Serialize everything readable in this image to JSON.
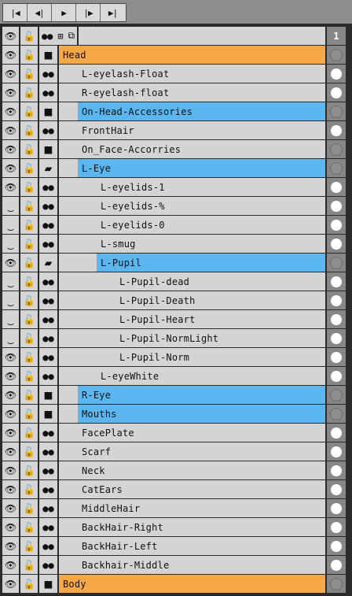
{
  "playback": {
    "buttons": [
      {
        "name": "first-frame-button",
        "glyph": "|◀"
      },
      {
        "name": "prev-frame-button",
        "glyph": "◀|"
      },
      {
        "name": "play-button",
        "glyph": "▶"
      },
      {
        "name": "next-frame-button",
        "glyph": "|▶"
      },
      {
        "name": "last-frame-button",
        "glyph": "▶|"
      }
    ]
  },
  "header": {
    "eye_icon": "👁",
    "lock_icon": "🔓",
    "dots_icon": "●●",
    "tree_icon": "⊞",
    "clone_icon": "⧉",
    "frame_number": "1"
  },
  "layers": [
    {
      "name": "Head",
      "kind": "folder",
      "depth": 0,
      "hl": "orange",
      "eye": true,
      "radio": "dim"
    },
    {
      "name": "L-eyelash-Float",
      "kind": "layer",
      "depth": 1,
      "hl": "",
      "eye": true,
      "radio": "white"
    },
    {
      "name": "R-eyelash-float",
      "kind": "layer",
      "depth": 1,
      "hl": "",
      "eye": true,
      "radio": "white"
    },
    {
      "name": "On-Head-Accessories",
      "kind": "folder",
      "depth": 1,
      "hl": "blue",
      "eye": true,
      "radio": "dim"
    },
    {
      "name": "FrontHair",
      "kind": "layer",
      "depth": 1,
      "hl": "",
      "eye": true,
      "radio": "white"
    },
    {
      "name": "On_Face-Accorries",
      "kind": "folder",
      "depth": 1,
      "hl": "",
      "eye": true,
      "radio": "dim"
    },
    {
      "name": "L-Eye",
      "kind": "folder-open",
      "depth": 1,
      "hl": "blue",
      "eye": true,
      "radio": "dim"
    },
    {
      "name": "L-eyelids-1",
      "kind": "layer",
      "depth": 2,
      "hl": "",
      "eye": true,
      "radio": "white"
    },
    {
      "name": "L-eyelids-%",
      "kind": "layer",
      "depth": 2,
      "hl": "",
      "eye": false,
      "radio": "white"
    },
    {
      "name": "L-eyelids-0",
      "kind": "layer",
      "depth": 2,
      "hl": "",
      "eye": false,
      "radio": "white"
    },
    {
      "name": "L-smug",
      "kind": "layer",
      "depth": 2,
      "hl": "",
      "eye": false,
      "radio": "white"
    },
    {
      "name": "L-Pupil",
      "kind": "folder-open",
      "depth": 2,
      "hl": "blue",
      "eye": true,
      "radio": "dim"
    },
    {
      "name": "L-Pupil-dead",
      "kind": "layer",
      "depth": 3,
      "hl": "",
      "eye": false,
      "radio": "white"
    },
    {
      "name": "L-Pupil-Death",
      "kind": "layer",
      "depth": 3,
      "hl": "",
      "eye": false,
      "radio": "white"
    },
    {
      "name": "L-Pupil-Heart",
      "kind": "layer",
      "depth": 3,
      "hl": "",
      "eye": false,
      "radio": "white"
    },
    {
      "name": "L-Pupil-NormLight",
      "kind": "layer",
      "depth": 3,
      "hl": "",
      "eye": false,
      "radio": "white"
    },
    {
      "name": "L-Pupil-Norm",
      "kind": "layer",
      "depth": 3,
      "hl": "",
      "eye": true,
      "radio": "white"
    },
    {
      "name": "L-eyeWhite",
      "kind": "layer",
      "depth": 2,
      "hl": "",
      "eye": true,
      "radio": "white"
    },
    {
      "name": "R-Eye",
      "kind": "folder",
      "depth": 1,
      "hl": "blue",
      "eye": true,
      "radio": "dim"
    },
    {
      "name": "Mouths",
      "kind": "folder",
      "depth": 1,
      "hl": "blue",
      "eye": true,
      "radio": "dim"
    },
    {
      "name": "FacePlate",
      "kind": "layer",
      "depth": 1,
      "hl": "",
      "eye": true,
      "radio": "white"
    },
    {
      "name": "Scarf",
      "kind": "layer",
      "depth": 1,
      "hl": "",
      "eye": true,
      "radio": "white"
    },
    {
      "name": "Neck",
      "kind": "layer",
      "depth": 1,
      "hl": "",
      "eye": true,
      "radio": "white"
    },
    {
      "name": "CatEars",
      "kind": "layer",
      "depth": 1,
      "hl": "",
      "eye": true,
      "radio": "white"
    },
    {
      "name": "MiddleHair",
      "kind": "layer",
      "depth": 1,
      "hl": "",
      "eye": true,
      "radio": "white"
    },
    {
      "name": "BackHair-Right",
      "kind": "layer",
      "depth": 1,
      "hl": "",
      "eye": true,
      "radio": "white"
    },
    {
      "name": "BackHair-Left",
      "kind": "layer",
      "depth": 1,
      "hl": "",
      "eye": true,
      "radio": "white"
    },
    {
      "name": "Backhair-Middle",
      "kind": "layer",
      "depth": 1,
      "hl": "",
      "eye": true,
      "radio": "white"
    },
    {
      "name": "Body",
      "kind": "folder",
      "depth": 0,
      "hl": "orange",
      "eye": true,
      "radio": "dim"
    }
  ],
  "icons": {
    "eye_open": "👁",
    "eye_closed": "‿",
    "lock": "🔓",
    "layer": "●●",
    "folder": "■",
    "folder_open": "▰"
  },
  "colors": {
    "orange": "#f7a846",
    "blue": "#5ab6ee",
    "row": "#d4d4d4",
    "panel": "#2b2b2b"
  }
}
